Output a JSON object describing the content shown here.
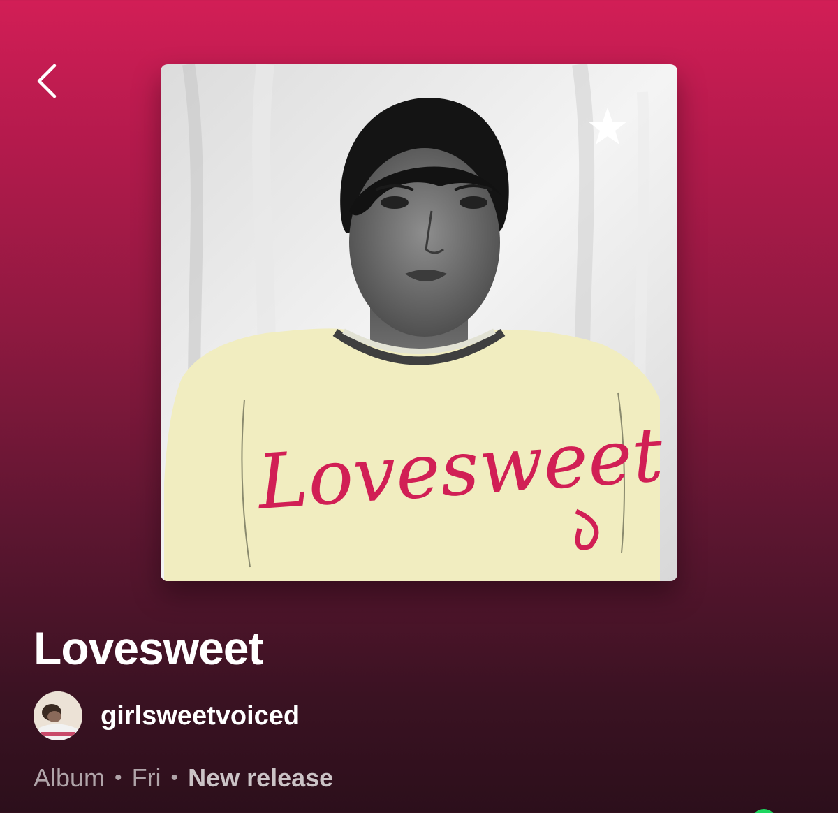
{
  "nav": {
    "back_icon": "chevron-left-icon"
  },
  "album": {
    "title": "Lovesweet",
    "cover_text": "Lovesweet",
    "type": "Album",
    "separator": "•",
    "day": "Fri",
    "badge": "New release"
  },
  "artist": {
    "name": "girlsweetvoiced",
    "avatar_icon": "artist-avatar"
  },
  "colors": {
    "gradient_top": "#d21e56",
    "gradient_bottom": "#2c0f1b",
    "cover_text": "#d11f55",
    "shirt": "#f1edc0"
  }
}
